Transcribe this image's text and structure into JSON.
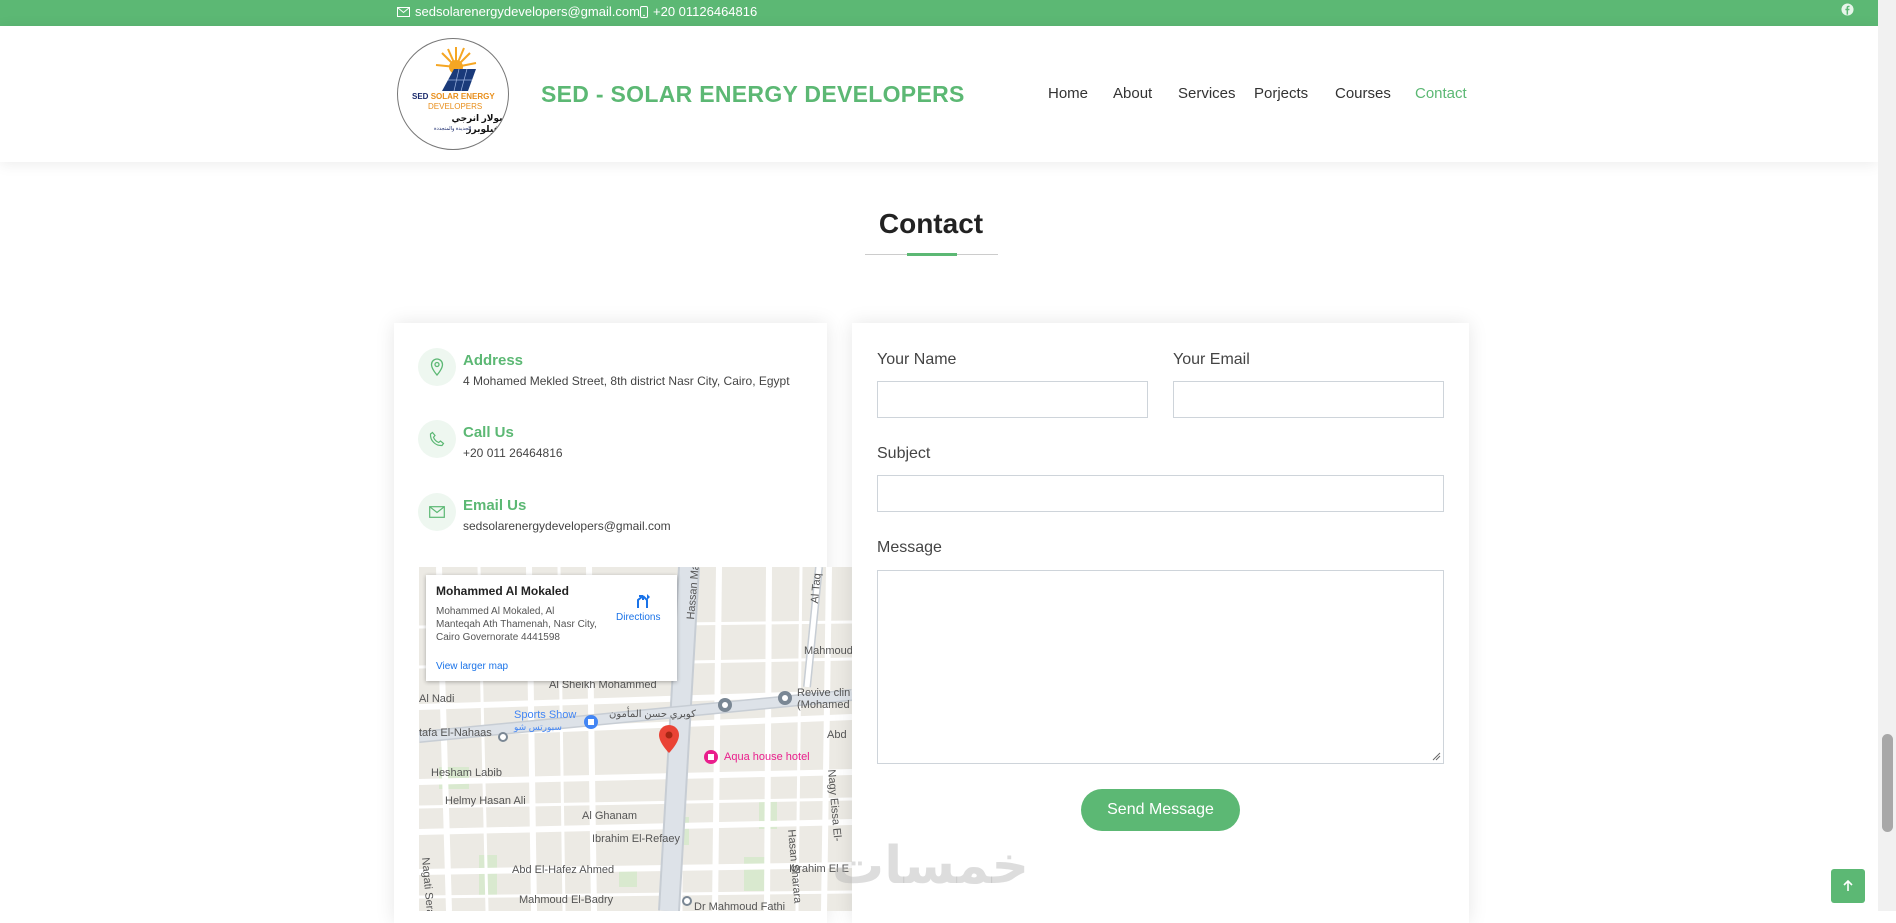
{
  "topbar": {
    "email": "sedsolarenergydevelopers@gmail.com",
    "phone": "+20 01126464816"
  },
  "header": {
    "logo": {
      "line1_a": "SED",
      "line1_b": "SOLAR ENERGY",
      "line2": "DEVELOPERS",
      "line3": "سولار انرجي ديفيلوبرز",
      "line4": "الجديدة والمتجددة"
    },
    "brand": "SED - SOLAR ENERGY DEVELOPERS",
    "nav": [
      "Home",
      "About",
      "Services",
      "Porjects",
      "Courses",
      "Contact"
    ]
  },
  "section": {
    "title": "Contact"
  },
  "info": {
    "address_title": "Address",
    "address_text": "4 Mohamed Mekled Street, 8th district Nasr City, Cairo, Egypt",
    "call_title": "Call Us",
    "call_text": "+20 011 26464816",
    "email_title": "Email Us",
    "email_text": "sedsolarenergydevelopers@gmail.com"
  },
  "map": {
    "place_name": "Mohammed Al Mokaled",
    "place_address": "Mohammed Al Mokaled, Al Manteqah Ath Thamenah, Nasr City, Cairo Governorate 4441598",
    "directions": "Directions",
    "view_larger": "View larger map",
    "labels": {
      "sports_show": "Sports Show",
      "sports_show_ar": "سبورتس شو",
      "aqua": "Aqua house hotel",
      "al_nadi": "Al Nadi",
      "mostafa": "tafa El-Nahaas",
      "hesham": "Hesham Labib",
      "helmy": "Helmy Hasan Ali",
      "ghanam": "Al Ghanam",
      "ibrahim": "Ibrahim El-Refaey",
      "abd": "Abd El-Hafez Ahmed",
      "mahmoud_badry": "Mahmoud El-Badry",
      "sheikh": "Al Sheikh Mohammed",
      "kobry": "كوبري حسن المأمون",
      "revive": "Revive clin",
      "revive2": "(Mohamed",
      "mahmoud": "Mahmoud",
      "hassan_ma": "Hassan Ma",
      "al_taq": "Al Taq",
      "hasan_sharara": "Hasan Sharara",
      "nagy": "Nagy Eissa El-",
      "ibrahim_e": "Ibrahim El E",
      "nagati": "Nagati Serag",
      "dr_mahmoud": "Dr Mahmoud Fathi",
      "abd2": "Abd"
    }
  },
  "form": {
    "name_label": "Your Name",
    "email_label": "Your Email",
    "subject_label": "Subject",
    "message_label": "Message",
    "send_label": "Send Message"
  },
  "watermark": "خمسات",
  "colors": {
    "accent": "#5cb874"
  }
}
